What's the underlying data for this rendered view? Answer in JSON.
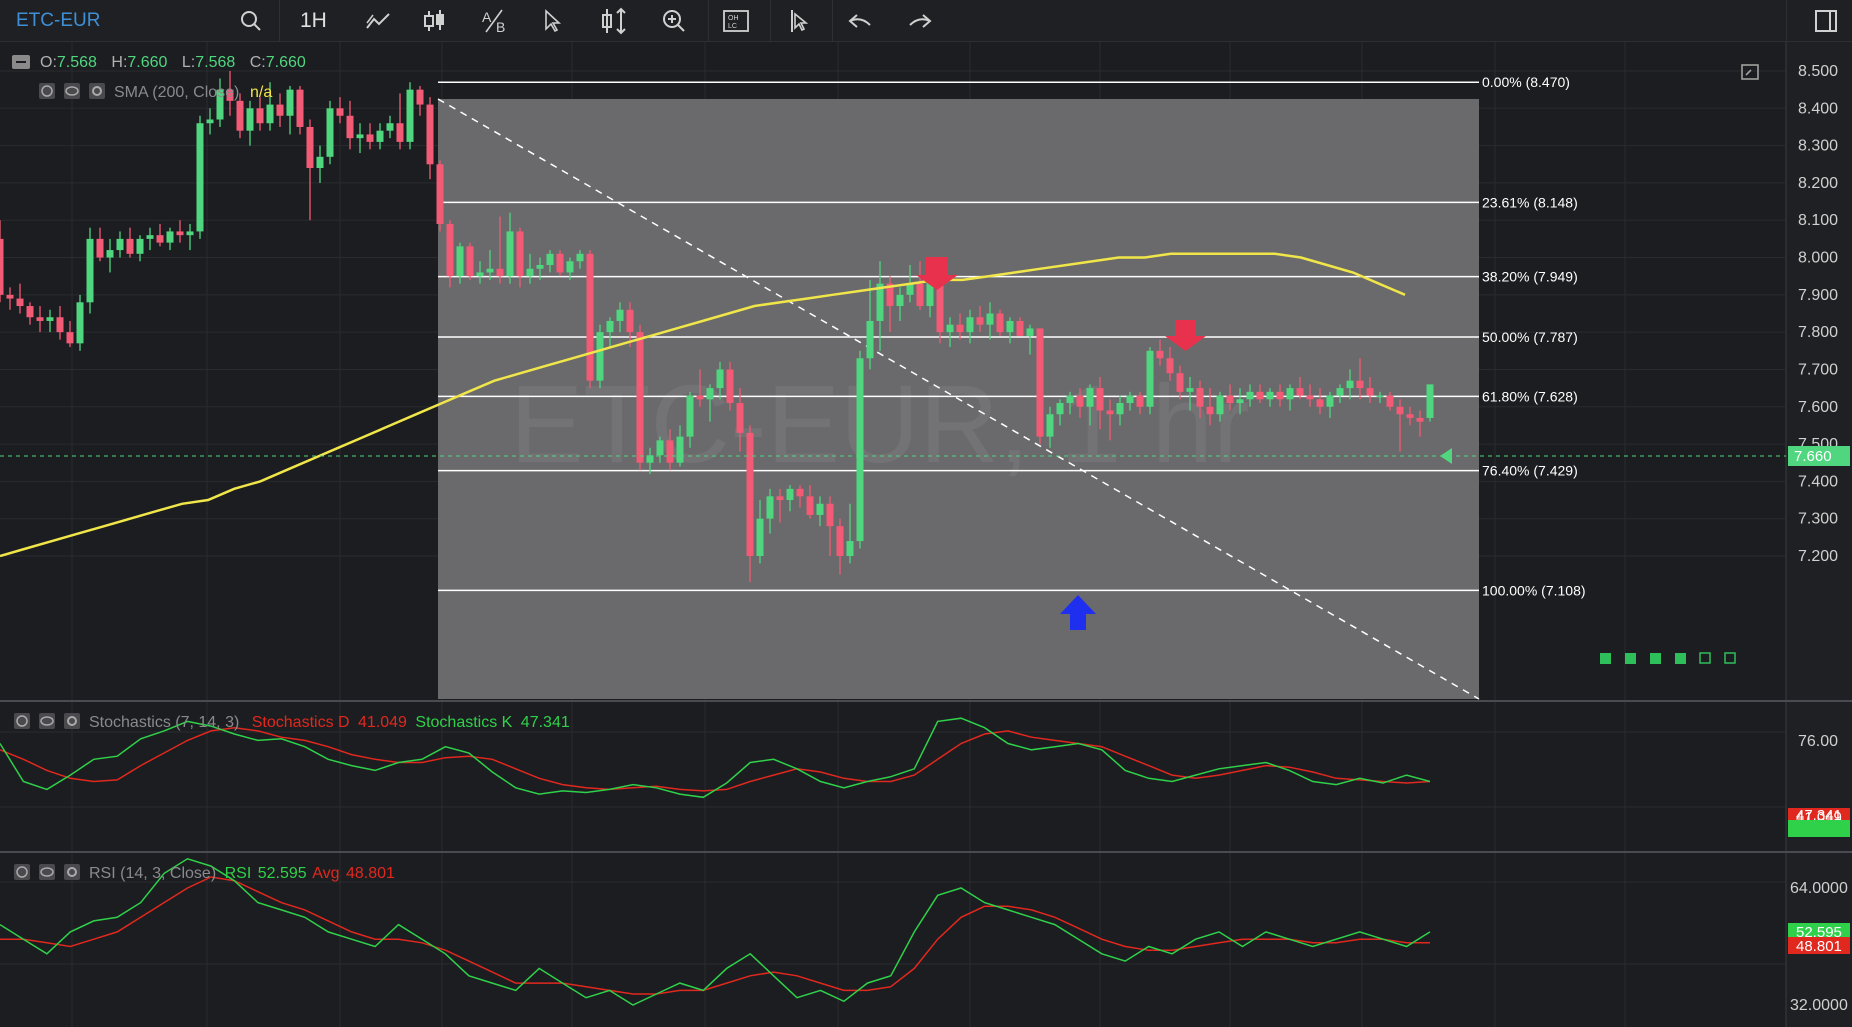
{
  "toolbar": {
    "symbol": "ETC-EUR",
    "interval": "1H",
    "icons": [
      "search-icon",
      "trendline-icon",
      "candlestick-icon",
      "compare-icon",
      "cursor-icon",
      "scale-icon",
      "zoom-icon",
      "ohlc-icon",
      "crosshair-icon",
      "undo-icon",
      "redo-icon",
      "window-icon"
    ]
  },
  "price_panel": {
    "ohlc": {
      "o_label": "O:",
      "o": "7.568",
      "h_label": "H:",
      "h": "7.660",
      "l_label": "L:",
      "l": "7.568",
      "c_label": "C:",
      "c": "7.660"
    },
    "sma_label": "SMA (200, Close)",
    "sma_value": "n/a",
    "watermark": "ETC-EUR, 1 hr",
    "y_ticks": [
      "8.500",
      "8.400",
      "8.300",
      "8.200",
      "8.100",
      "8.000",
      "7.900",
      "7.800",
      "7.700",
      "7.600",
      "7.500",
      "7.400",
      "7.300",
      "7.200"
    ],
    "current_price": "7.660",
    "fib_levels": [
      {
        "label": "0.00% (8.470)",
        "price": 8.47
      },
      {
        "label": "23.61% (8.148)",
        "price": 8.148
      },
      {
        "label": "38.20% (7.949)",
        "price": 7.949
      },
      {
        "label": "50.00% (7.787)",
        "price": 7.787
      },
      {
        "label": "61.80% (7.628)",
        "price": 7.628
      },
      {
        "label": "76.40% (7.429)",
        "price": 7.429
      },
      {
        "label": "100.00% (7.108)",
        "price": 7.108
      }
    ]
  },
  "stoch_panel": {
    "label": "Stochastics (7, 14, 3)",
    "d_label": "Stochastics D",
    "d_value": "41.049",
    "k_label": "Stochastics K",
    "k_value": "47.341",
    "y_ticks": [
      "76.00"
    ],
    "k_badge": "47.341",
    "d_badge": "41.049"
  },
  "rsi_panel": {
    "label": "RSI (14, 3, Close)",
    "rsi_label": "RSI",
    "rsi_value": "52.595",
    "avg_label": "Avg",
    "avg_value": "48.801",
    "y_ticks": [
      "64.0000",
      "32.0000"
    ],
    "rsi_badge": "52.595",
    "avg_badge": "48.801"
  },
  "colors": {
    "up": "#4fd67f",
    "down": "#f25a76",
    "sma": "#f0e64a",
    "stoch_k": "#2fd14a",
    "stoch_d": "#e0281e",
    "rsi": "#2fd14a",
    "rsi_avg": "#e0281e",
    "fib_box": "#6a6a6c",
    "arrow_down": "#e8314d",
    "arrow_up": "#1e2ff0"
  },
  "chart_data": {
    "type": "candlestick",
    "ylim": [
      7.11,
      8.52
    ],
    "candles": [
      [
        8.05,
        8.1,
        7.88,
        7.9
      ],
      [
        7.9,
        7.92,
        7.86,
        7.89
      ],
      [
        7.89,
        7.93,
        7.85,
        7.87
      ],
      [
        7.87,
        7.88,
        7.82,
        7.84
      ],
      [
        7.84,
        7.87,
        7.8,
        7.83
      ],
      [
        7.83,
        7.86,
        7.8,
        7.84
      ],
      [
        7.84,
        7.87,
        7.78,
        7.8
      ],
      [
        7.8,
        7.83,
        7.76,
        7.77
      ],
      [
        7.77,
        7.9,
        7.75,
        7.88
      ],
      [
        7.88,
        8.08,
        7.85,
        8.05
      ],
      [
        8.05,
        8.08,
        7.99,
        8.0
      ],
      [
        8.0,
        8.05,
        7.96,
        8.02
      ],
      [
        8.02,
        8.07,
        8.0,
        8.05
      ],
      [
        8.05,
        8.08,
        8.0,
        8.01
      ],
      [
        8.01,
        8.06,
        7.99,
        8.05
      ],
      [
        8.05,
        8.08,
        8.02,
        8.06
      ],
      [
        8.06,
        8.09,
        8.03,
        8.04
      ],
      [
        8.04,
        8.08,
        8.02,
        8.07
      ],
      [
        8.07,
        8.1,
        8.04,
        8.06
      ],
      [
        8.06,
        8.09,
        8.02,
        8.07
      ],
      [
        8.07,
        8.38,
        8.05,
        8.36
      ],
      [
        8.36,
        8.4,
        8.33,
        8.37
      ],
      [
        8.37,
        8.48,
        8.35,
        8.45
      ],
      [
        8.45,
        8.5,
        8.38,
        8.42
      ],
      [
        8.42,
        8.44,
        8.32,
        8.34
      ],
      [
        8.34,
        8.42,
        8.3,
        8.4
      ],
      [
        8.4,
        8.43,
        8.34,
        8.36
      ],
      [
        8.36,
        8.47,
        8.34,
        8.41
      ],
      [
        8.41,
        8.44,
        8.35,
        8.38
      ],
      [
        8.38,
        8.46,
        8.33,
        8.45
      ],
      [
        8.45,
        8.46,
        8.33,
        8.35
      ],
      [
        8.35,
        8.37,
        8.1,
        8.24
      ],
      [
        8.24,
        8.3,
        8.2,
        8.27
      ],
      [
        8.27,
        8.42,
        8.25,
        8.4
      ],
      [
        8.4,
        8.43,
        8.36,
        8.38
      ],
      [
        8.38,
        8.42,
        8.29,
        8.32
      ],
      [
        8.32,
        8.36,
        8.28,
        8.33
      ],
      [
        8.33,
        8.36,
        8.29,
        8.31
      ],
      [
        8.31,
        8.36,
        8.29,
        8.34
      ],
      [
        8.34,
        8.38,
        8.32,
        8.36
      ],
      [
        8.36,
        8.44,
        8.29,
        8.31
      ],
      [
        8.31,
        8.47,
        8.29,
        8.45
      ],
      [
        8.45,
        8.46,
        8.38,
        8.41
      ],
      [
        8.41,
        8.43,
        8.21,
        8.25
      ],
      [
        8.25,
        8.26,
        8.07,
        8.09
      ],
      [
        8.09,
        8.1,
        7.92,
        7.95
      ],
      [
        7.95,
        8.04,
        7.93,
        8.03
      ],
      [
        8.03,
        8.04,
        7.94,
        7.95
      ],
      [
        7.95,
        7.99,
        7.93,
        7.96
      ],
      [
        7.96,
        8.02,
        7.94,
        7.97
      ],
      [
        7.97,
        8.11,
        7.93,
        7.95
      ],
      [
        7.95,
        8.12,
        7.93,
        8.07
      ],
      [
        8.07,
        8.08,
        7.92,
        7.95
      ],
      [
        7.95,
        8.01,
        7.93,
        7.97
      ],
      [
        7.97,
        8.0,
        7.94,
        7.98
      ],
      [
        7.98,
        8.02,
        7.96,
        8.01
      ],
      [
        8.01,
        8.02,
        7.95,
        7.96
      ],
      [
        7.96,
        8.0,
        7.94,
        7.99
      ],
      [
        7.99,
        8.02,
        7.97,
        8.01
      ],
      [
        8.01,
        8.02,
        7.65,
        7.67
      ],
      [
        7.67,
        7.82,
        7.65,
        7.8
      ],
      [
        7.8,
        7.84,
        7.76,
        7.83
      ],
      [
        7.83,
        7.88,
        7.8,
        7.86
      ],
      [
        7.86,
        7.88,
        7.76,
        7.8
      ],
      [
        7.8,
        7.82,
        7.43,
        7.45
      ],
      [
        7.45,
        7.49,
        7.42,
        7.47
      ],
      [
        7.47,
        7.52,
        7.45,
        7.51
      ],
      [
        7.51,
        7.54,
        7.43,
        7.45
      ],
      [
        7.45,
        7.55,
        7.44,
        7.52
      ],
      [
        7.52,
        7.64,
        7.49,
        7.63
      ],
      [
        7.63,
        7.7,
        7.6,
        7.62
      ],
      [
        7.62,
        7.66,
        7.56,
        7.65
      ],
      [
        7.65,
        7.72,
        7.62,
        7.7
      ],
      [
        7.7,
        7.72,
        7.59,
        7.61
      ],
      [
        7.61,
        7.65,
        7.48,
        7.53
      ],
      [
        7.53,
        7.55,
        7.13,
        7.2
      ],
      [
        7.2,
        7.35,
        7.18,
        7.3
      ],
      [
        7.3,
        7.38,
        7.26,
        7.36
      ],
      [
        7.36,
        7.38,
        7.29,
        7.35
      ],
      [
        7.35,
        7.39,
        7.32,
        7.38
      ],
      [
        7.38,
        7.39,
        7.33,
        7.36
      ],
      [
        7.36,
        7.39,
        7.3,
        7.31
      ],
      [
        7.31,
        7.36,
        7.28,
        7.34
      ],
      [
        7.34,
        7.36,
        7.2,
        7.28
      ],
      [
        7.28,
        7.3,
        7.15,
        7.2
      ],
      [
        7.2,
        7.34,
        7.18,
        7.24
      ],
      [
        7.24,
        7.75,
        7.22,
        7.73
      ],
      [
        7.73,
        7.94,
        7.7,
        7.83
      ],
      [
        7.83,
        7.99,
        7.75,
        7.93
      ],
      [
        7.93,
        7.95,
        7.8,
        7.87
      ],
      [
        7.87,
        7.92,
        7.83,
        7.9
      ],
      [
        7.9,
        7.98,
        7.88,
        7.93
      ],
      [
        7.93,
        7.99,
        7.86,
        7.87
      ],
      [
        7.87,
        7.98,
        7.84,
        7.96
      ],
      [
        7.96,
        7.98,
        7.77,
        7.8
      ],
      [
        7.8,
        7.84,
        7.76,
        7.82
      ],
      [
        7.82,
        7.85,
        7.78,
        7.8
      ],
      [
        7.8,
        7.86,
        7.77,
        7.84
      ],
      [
        7.84,
        7.87,
        7.8,
        7.82
      ],
      [
        7.82,
        7.88,
        7.78,
        7.85
      ],
      [
        7.85,
        7.86,
        7.79,
        7.8
      ],
      [
        7.8,
        7.84,
        7.77,
        7.83
      ],
      [
        7.83,
        7.84,
        7.79,
        7.79
      ],
      [
        7.79,
        7.82,
        7.74,
        7.81
      ],
      [
        7.81,
        7.81,
        7.5,
        7.52
      ],
      [
        7.52,
        7.6,
        7.49,
        7.58
      ],
      [
        7.58,
        7.62,
        7.55,
        7.61
      ],
      [
        7.61,
        7.64,
        7.58,
        7.63
      ],
      [
        7.63,
        7.65,
        7.57,
        7.6
      ],
      [
        7.6,
        7.66,
        7.55,
        7.65
      ],
      [
        7.65,
        7.68,
        7.54,
        7.59
      ],
      [
        7.59,
        7.62,
        7.51,
        7.58
      ],
      [
        7.58,
        7.63,
        7.55,
        7.61
      ],
      [
        7.61,
        7.64,
        7.59,
        7.63
      ],
      [
        7.63,
        7.64,
        7.58,
        7.6
      ],
      [
        7.6,
        7.76,
        7.58,
        7.75
      ],
      [
        7.75,
        7.78,
        7.71,
        7.73
      ],
      [
        7.73,
        7.76,
        7.67,
        7.69
      ],
      [
        7.69,
        7.71,
        7.62,
        7.64
      ],
      [
        7.64,
        7.68,
        7.59,
        7.65
      ],
      [
        7.65,
        7.67,
        7.57,
        7.6
      ],
      [
        7.6,
        7.65,
        7.55,
        7.58
      ],
      [
        7.58,
        7.64,
        7.56,
        7.63
      ],
      [
        7.63,
        7.66,
        7.59,
        7.61
      ],
      [
        7.61,
        7.65,
        7.58,
        7.62
      ],
      [
        7.62,
        7.66,
        7.6,
        7.64
      ],
      [
        7.64,
        7.66,
        7.61,
        7.62
      ],
      [
        7.62,
        7.65,
        7.6,
        7.64
      ],
      [
        7.64,
        7.66,
        7.6,
        7.62
      ],
      [
        7.62,
        7.66,
        7.59,
        7.65
      ],
      [
        7.65,
        7.68,
        7.62,
        7.63
      ],
      [
        7.63,
        7.66,
        7.6,
        7.62
      ],
      [
        7.62,
        7.65,
        7.58,
        7.6
      ],
      [
        7.6,
        7.64,
        7.57,
        7.63
      ],
      [
        7.63,
        7.66,
        7.61,
        7.65
      ],
      [
        7.65,
        7.7,
        7.62,
        7.67
      ],
      [
        7.67,
        7.73,
        7.62,
        7.65
      ],
      [
        7.65,
        7.68,
        7.61,
        7.63
      ],
      [
        7.63,
        7.64,
        7.61,
        7.63
      ],
      [
        7.63,
        7.64,
        7.59,
        7.6
      ],
      [
        7.6,
        7.62,
        7.48,
        7.58
      ],
      [
        7.58,
        7.6,
        7.55,
        7.57
      ],
      [
        7.57,
        7.59,
        7.52,
        7.56
      ],
      [
        7.57,
        7.66,
        7.56,
        7.66
      ]
    ],
    "sma": [
      7.2,
      7.22,
      7.24,
      7.26,
      7.28,
      7.3,
      7.32,
      7.34,
      7.35,
      7.38,
      7.4,
      7.43,
      7.46,
      7.49,
      7.52,
      7.55,
      7.58,
      7.61,
      7.64,
      7.67,
      7.69,
      7.71,
      7.73,
      7.75,
      7.77,
      7.79,
      7.81,
      7.83,
      7.85,
      7.87,
      7.88,
      7.89,
      7.9,
      7.91,
      7.92,
      7.93,
      7.94,
      7.94,
      7.95,
      7.96,
      7.97,
      7.98,
      7.99,
      8.0,
      8.0,
      8.01,
      8.01,
      8.01,
      8.01,
      8.01,
      8.0,
      7.98,
      7.96,
      7.93,
      7.9
    ],
    "stoch_k": [
      72,
      48,
      43,
      52,
      62,
      64,
      75,
      80,
      86,
      83,
      78,
      74,
      75,
      70,
      62,
      58,
      55,
      60,
      62,
      70,
      66,
      54,
      44,
      40,
      42,
      41,
      43,
      46,
      44,
      40,
      38,
      47,
      60,
      62,
      56,
      48,
      44,
      48,
      51,
      56,
      86,
      88,
      82,
      72,
      68,
      70,
      72,
      68,
      55,
      50,
      48,
      52,
      56,
      58,
      60,
      55,
      48,
      46,
      50,
      47,
      52,
      48
    ],
    "stoch_d": [
      68,
      62,
      55,
      50,
      48,
      49,
      58,
      66,
      74,
      80,
      82,
      80,
      76,
      74,
      70,
      65,
      62,
      60,
      60,
      63,
      64,
      62,
      56,
      50,
      46,
      44,
      43,
      44,
      45,
      43,
      42,
      43,
      48,
      52,
      56,
      54,
      50,
      48,
      48,
      52,
      62,
      72,
      78,
      80,
      76,
      74,
      72,
      70,
      64,
      58,
      52,
      50,
      52,
      55,
      58,
      57,
      54,
      50,
      49,
      48,
      47,
      48
    ],
    "rsi": [
      54,
      50,
      46,
      52,
      55,
      56,
      60,
      68,
      72,
      70,
      66,
      60,
      58,
      56,
      52,
      50,
      48,
      54,
      50,
      46,
      40,
      38,
      36,
      42,
      38,
      34,
      36,
      32,
      35,
      38,
      36,
      42,
      46,
      40,
      34,
      36,
      33,
      38,
      40,
      52,
      62,
      64,
      60,
      58,
      56,
      54,
      50,
      46,
      44,
      48,
      46,
      50,
      52,
      48,
      52,
      50,
      48,
      50,
      52,
      50,
      48,
      52
    ],
    "rsi_avg": [
      50,
      50,
      49,
      48,
      50,
      52,
      56,
      60,
      64,
      67,
      66,
      63,
      60,
      58,
      55,
      52,
      50,
      50,
      49,
      47,
      44,
      41,
      38,
      38,
      38,
      37,
      36,
      35,
      35,
      36,
      36,
      38,
      40,
      41,
      40,
      38,
      36,
      36,
      37,
      42,
      50,
      56,
      59,
      59,
      58,
      56,
      53,
      50,
      48,
      47,
      47,
      48,
      49,
      50,
      50,
      50,
      49,
      49,
      50,
      50,
      49,
      49
    ]
  }
}
